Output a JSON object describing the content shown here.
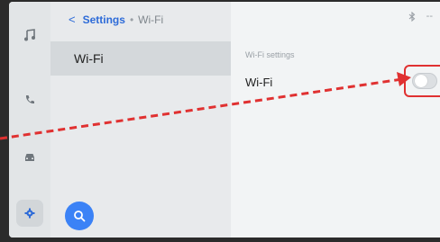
{
  "breadcrumb": {
    "back_glyph": "<",
    "title": "Settings",
    "separator": "•",
    "current": "Wi-Fi"
  },
  "list": {
    "items": [
      {
        "label": "Wi-Fi",
        "selected": true
      }
    ]
  },
  "detail": {
    "section_label": "Wi-Fi settings",
    "wifi_row_label": "Wi-Fi",
    "wifi_enabled": false
  },
  "status_bar": {
    "icons": [
      "bluetooth-icon"
    ],
    "trailing_text": "--"
  },
  "sidebar": {
    "items": [
      {
        "icon": "music-icon"
      },
      {
        "icon": "phone-icon"
      },
      {
        "icon": "car-icon"
      },
      {
        "icon": "gear-icon",
        "active": true
      }
    ]
  },
  "colors": {
    "accent": "#2d6bd8",
    "search_button": "#3b82f6",
    "highlight_red": "#e03131"
  }
}
